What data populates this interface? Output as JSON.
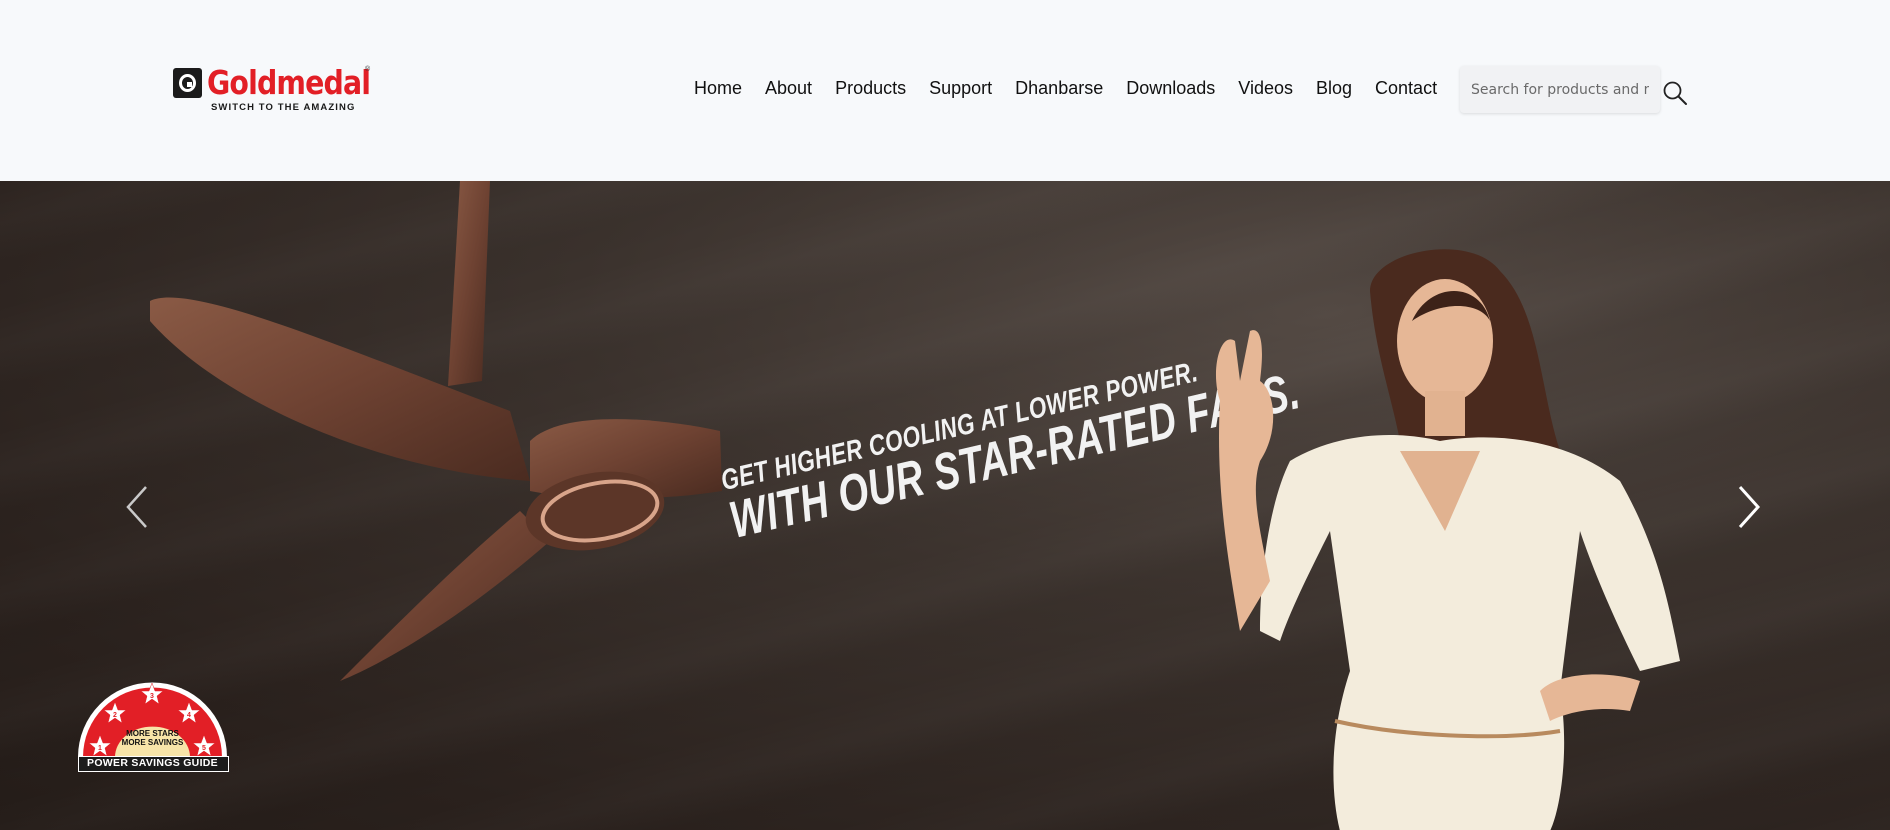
{
  "brand": {
    "name": "Goldmedal",
    "tagline": "SWITCH TO THE AMAZING",
    "primary_color": "#e21f26"
  },
  "nav": {
    "items": [
      {
        "label": "Home"
      },
      {
        "label": "About"
      },
      {
        "label": "Products"
      },
      {
        "label": "Support"
      },
      {
        "label": "Dhanbarse"
      },
      {
        "label": "Downloads"
      },
      {
        "label": "Videos"
      },
      {
        "label": "Blog"
      },
      {
        "label": "Contact"
      }
    ]
  },
  "search": {
    "placeholder": "Search for products and m",
    "value": "",
    "icon": "search-icon"
  },
  "hero": {
    "headline_line1": "GET HIGHER COOLING AT LOWER POWER.",
    "headline_line2": "WITH OUR STAR-RATED FANS.",
    "prev_icon": "chevron-left-icon",
    "next_icon": "chevron-right-icon",
    "badge": {
      "line1": "MORE STARS",
      "line2": "MORE SAVINGS",
      "line3": "POWER SAVINGS GUIDE",
      "stars": [
        "1",
        "2",
        "3",
        "4",
        "5"
      ]
    }
  }
}
